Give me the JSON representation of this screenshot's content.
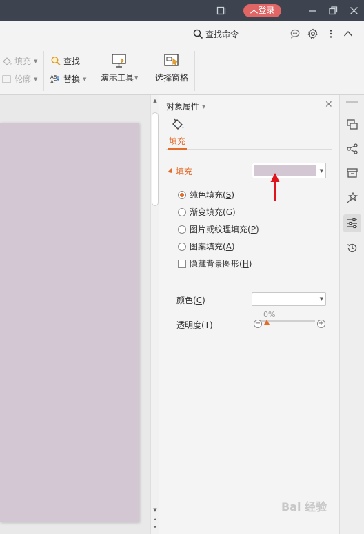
{
  "titlebar": {
    "login_label": "未登录"
  },
  "command_bar": {
    "search_label": "查找命令"
  },
  "ribbon": {
    "fill_label": "填充",
    "outline_label": "轮廓",
    "find_label": "查找",
    "replace_label": "替换",
    "present_tools_label": "演示工具",
    "select_pane_label": "选择窗格"
  },
  "pane": {
    "title": "对象属性",
    "tab_fill": "填充",
    "section_fill": "填充",
    "fill_color": "#d2c7d3",
    "options": [
      {
        "label": "纯色填充(",
        "key": "S",
        "selected": true
      },
      {
        "label": "渐变填充(",
        "key": "G",
        "selected": false
      },
      {
        "label": "图片或纹理填充(",
        "key": "P",
        "selected": false
      },
      {
        "label": "图案填充(",
        "key": "A",
        "selected": false
      }
    ],
    "hide_bg_label": "隐藏背景图形(",
    "hide_bg_key": "H",
    "color_label": "颜色(",
    "color_key": "C",
    "transparency_label": "透明度(",
    "transparency_key": "T",
    "transparency_value": "0%"
  },
  "slide": {
    "background_color": "#d2c7d3"
  },
  "watermark": "Bai 经验"
}
